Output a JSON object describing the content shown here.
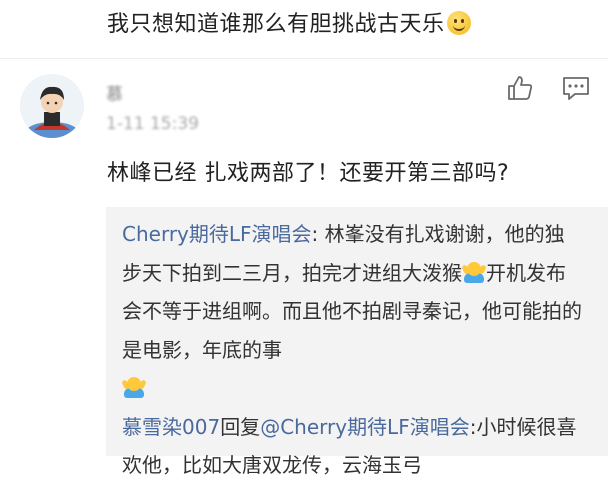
{
  "post": {
    "text": "我只想知道谁那么有胆挑战古天乐"
  },
  "comment": {
    "username": "慕",
    "timestamp": "1-11 15:39",
    "text": "林峰已经 扎戏两部了！还要开第三部吗?"
  },
  "replies": {
    "first": {
      "author": "Cherry期待LF演唱会",
      "text_1": ": 林峯没有扎戏谢谢，他的独步天下拍到二三月，拍完才进组大泼猴",
      "text_2": "开机发布会不等于进组啊。而且他不拍剧寻秦记，他可能拍的是电影，年底的事"
    },
    "second": {
      "author": "慕雪染007",
      "reply_word": "回复",
      "mention": "@Cherry期待LF演唱会",
      "text": ":小时候很喜欢他，比如大唐双龙传，云海玉弓"
    }
  },
  "icons": {
    "like": "thumbs-up-icon",
    "comment": "comment-icon",
    "smile": "smile-emoji-icon",
    "shrug": "shrug-emoji-icon"
  },
  "colors": {
    "link": "#4a6a9e",
    "reply_bg": "#f3f3f3",
    "meta": "#a8a8a8"
  }
}
